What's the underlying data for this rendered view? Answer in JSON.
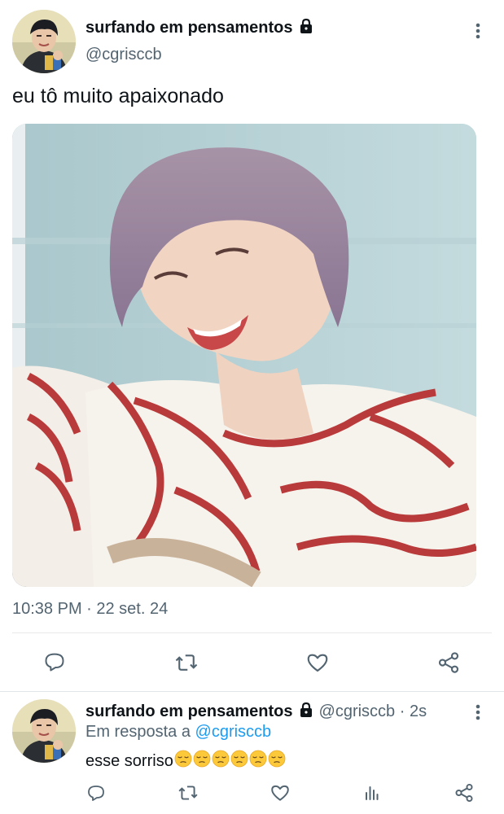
{
  "tweet": {
    "display_name": "surfando em pensamentos",
    "handle": "@cgrisccb",
    "text": "eu tô muito apaixonado",
    "timestamp": "10:38 PM · 22 set. 24",
    "actions": [
      "reply-icon",
      "retweet-icon",
      "like-icon",
      "share-icon"
    ]
  },
  "reply": {
    "display_name": "surfando em pensamentos",
    "handle": "@cgrisccb",
    "age": "· 2s",
    "replying_prefix": "Em resposta a ",
    "replying_to": "@cgrisccb",
    "text": "esse sorriso",
    "emoji": "pensive-face-icon",
    "emoji_count": 6,
    "actions": [
      "reply-icon",
      "retweet-icon",
      "like-icon",
      "views-icon",
      "share-icon"
    ]
  },
  "colors": {
    "text": "#0f1419",
    "secondary": "#536471",
    "link": "#1d9bf0",
    "divider": "#e7e9ea"
  }
}
